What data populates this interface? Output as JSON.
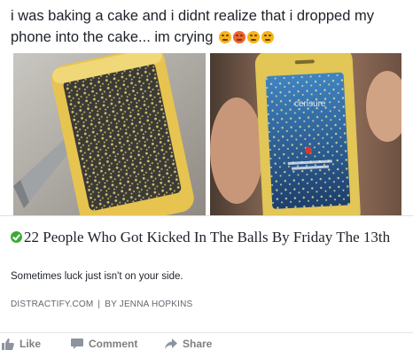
{
  "post": {
    "text": "i was baking a cake and i didnt realize that i dropped my phone into the cake... im crying"
  },
  "link": {
    "title": "22 People Who Got Kicked In The Balls By Friday The 13th",
    "description": "Sometimes luck just isn't on your side.",
    "domain": "DISTRACTIFY.COM",
    "separator": "|",
    "byline": "BY JENNA HOPKINS"
  },
  "actions": {
    "like": "Like",
    "comment": "Comment",
    "share": "Share"
  },
  "photo_right": {
    "screen_text": "censure"
  },
  "colors": {
    "text": "#1d2129",
    "muted": "#606770",
    "action": "#7f7f7f",
    "check": "#3cab35",
    "cake": "#d9b84c"
  }
}
